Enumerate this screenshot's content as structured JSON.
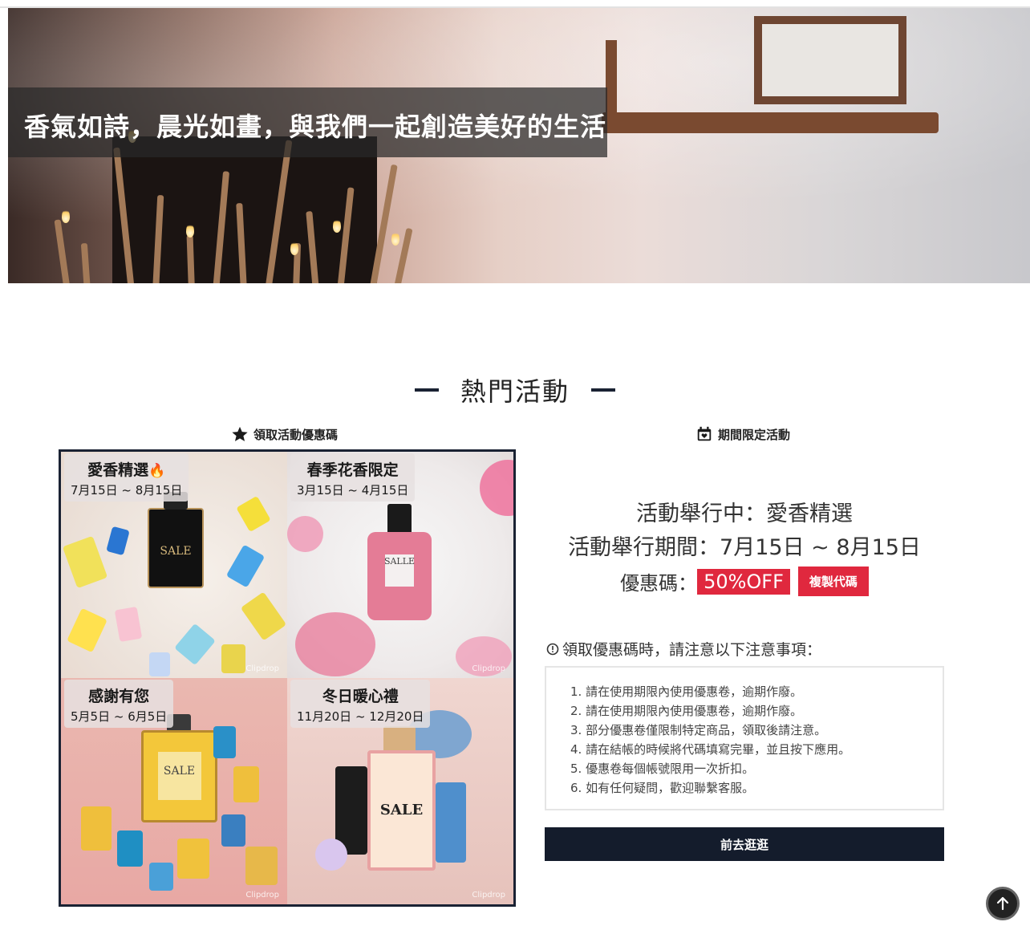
{
  "hero": {
    "caption": "香氣如詩，晨光如畫，與我們一起創造美好的生活"
  },
  "section": {
    "title": "熱門活動"
  },
  "columns": {
    "left_heading": "領取活動優惠碼",
    "right_heading": "期間限定活動"
  },
  "events": [
    {
      "name": "愛香精選",
      "date": "7月15日 ~ 8月15日",
      "hot": true,
      "watermark": "Clipdrop",
      "bottle_text": "SALE"
    },
    {
      "name": "春季花香限定",
      "date": "3月15日 ~ 4月15日",
      "hot": false,
      "watermark": "Clipdrop",
      "bottle_text": "SALLE"
    },
    {
      "name": "感謝有您",
      "date": "5月5日 ~ 6月5日",
      "hot": false,
      "watermark": "Clipdrop",
      "bottle_text": "SALE"
    },
    {
      "name": "冬日暖心禮",
      "date": "11月20日 ~ 12月20日",
      "hot": false,
      "watermark": "Clipdrop",
      "bottle_text": "SALE"
    }
  ],
  "current": {
    "line1": "活動舉行中：愛香精選",
    "line2": "活動舉行期間：7月15日 ~ 8月15日",
    "code_label": "優惠碼：",
    "code": "50%OFF",
    "copy_label": "複製代碼"
  },
  "notice": {
    "title": "領取優惠碼時，請注意以下注意事項：",
    "items": [
      "1. 請在使用期限內使用優惠卷，逾期作廢。",
      "2. 請在使用期限內使用優惠卷，逾期作廢。",
      "3. 部分優惠卷僅限制特定商品，領取後請注意。",
      "4. 請在結帳的時候將代碼填寫完畢，並且按下應用。",
      "5. 優惠卷每個帳號限用一次折扣。",
      "6. 如有任何疑問，歡迎聯繫客服。"
    ]
  },
  "go_button": "前去逛逛",
  "colors": {
    "navy": "#141c2c",
    "accent_red": "#e0283e"
  },
  "icons": {
    "left_heading": "star-icon",
    "right_heading": "calendar-heart-icon",
    "notice": "info-circle-icon",
    "hot": "fire-icon",
    "back_to_top": "arrow-up-icon"
  }
}
